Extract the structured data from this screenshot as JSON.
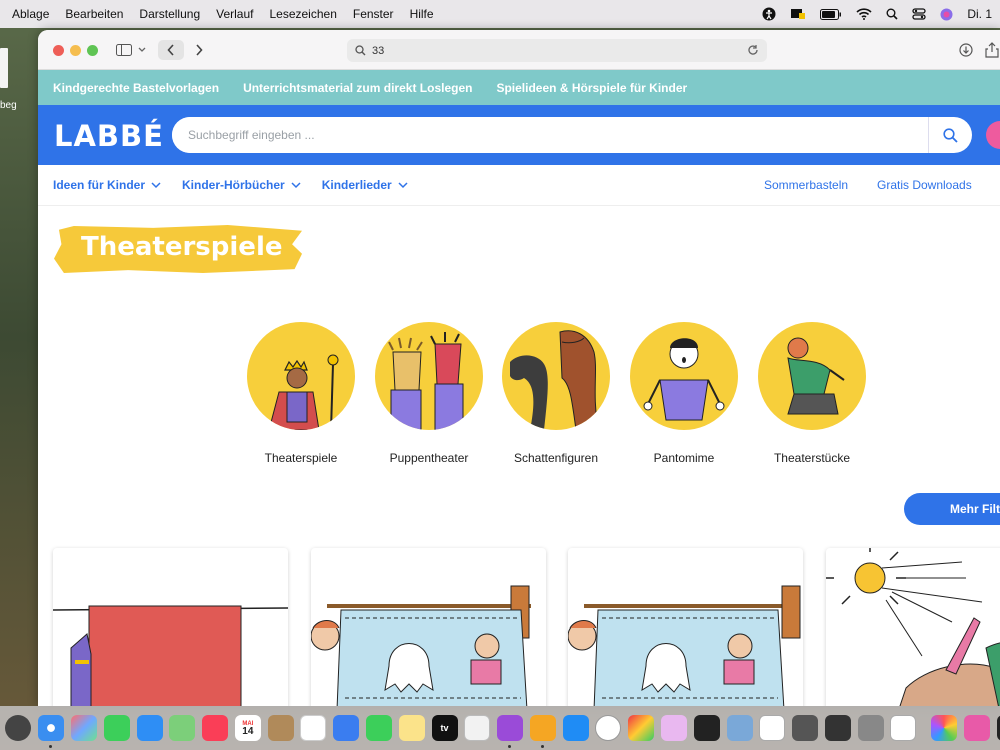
{
  "menubar": {
    "items": [
      "Ablage",
      "Bearbeiten",
      "Darstellung",
      "Verlauf",
      "Lesezeichen",
      "Fenster",
      "Hilfe"
    ],
    "clock": "Di. 1"
  },
  "desktop": {
    "label": "beg"
  },
  "browser": {
    "url": "33"
  },
  "site": {
    "top_links": [
      "Kindgerechte Bastelvorlagen",
      "Unterrichtsmaterial zum direkt Loslegen",
      "Spielideen & Hörspiele für Kinder"
    ],
    "logo": "LABBÉ",
    "search_placeholder": "Suchbegriff eingeben ...",
    "nav": [
      "Ideen für Kinder",
      "Kinder-Hörbücher",
      "Kinderlieder"
    ],
    "nav_right": [
      "Sommerbasteln",
      "Gratis Downloads"
    ],
    "page_title": "Theaterspiele",
    "categories": [
      "Theaterspiele",
      "Puppentheater",
      "Schattenfiguren",
      "Pantomime",
      "Theaterstücke"
    ],
    "filter_button": "Mehr Filt"
  },
  "dock": {
    "calendar_month": "MAI",
    "calendar_day": "14",
    "tv_label": "tv"
  },
  "colors": {
    "brand_blue": "#2f73e8",
    "teal": "#7fc9c9",
    "yellow": "#f7cf3b"
  }
}
